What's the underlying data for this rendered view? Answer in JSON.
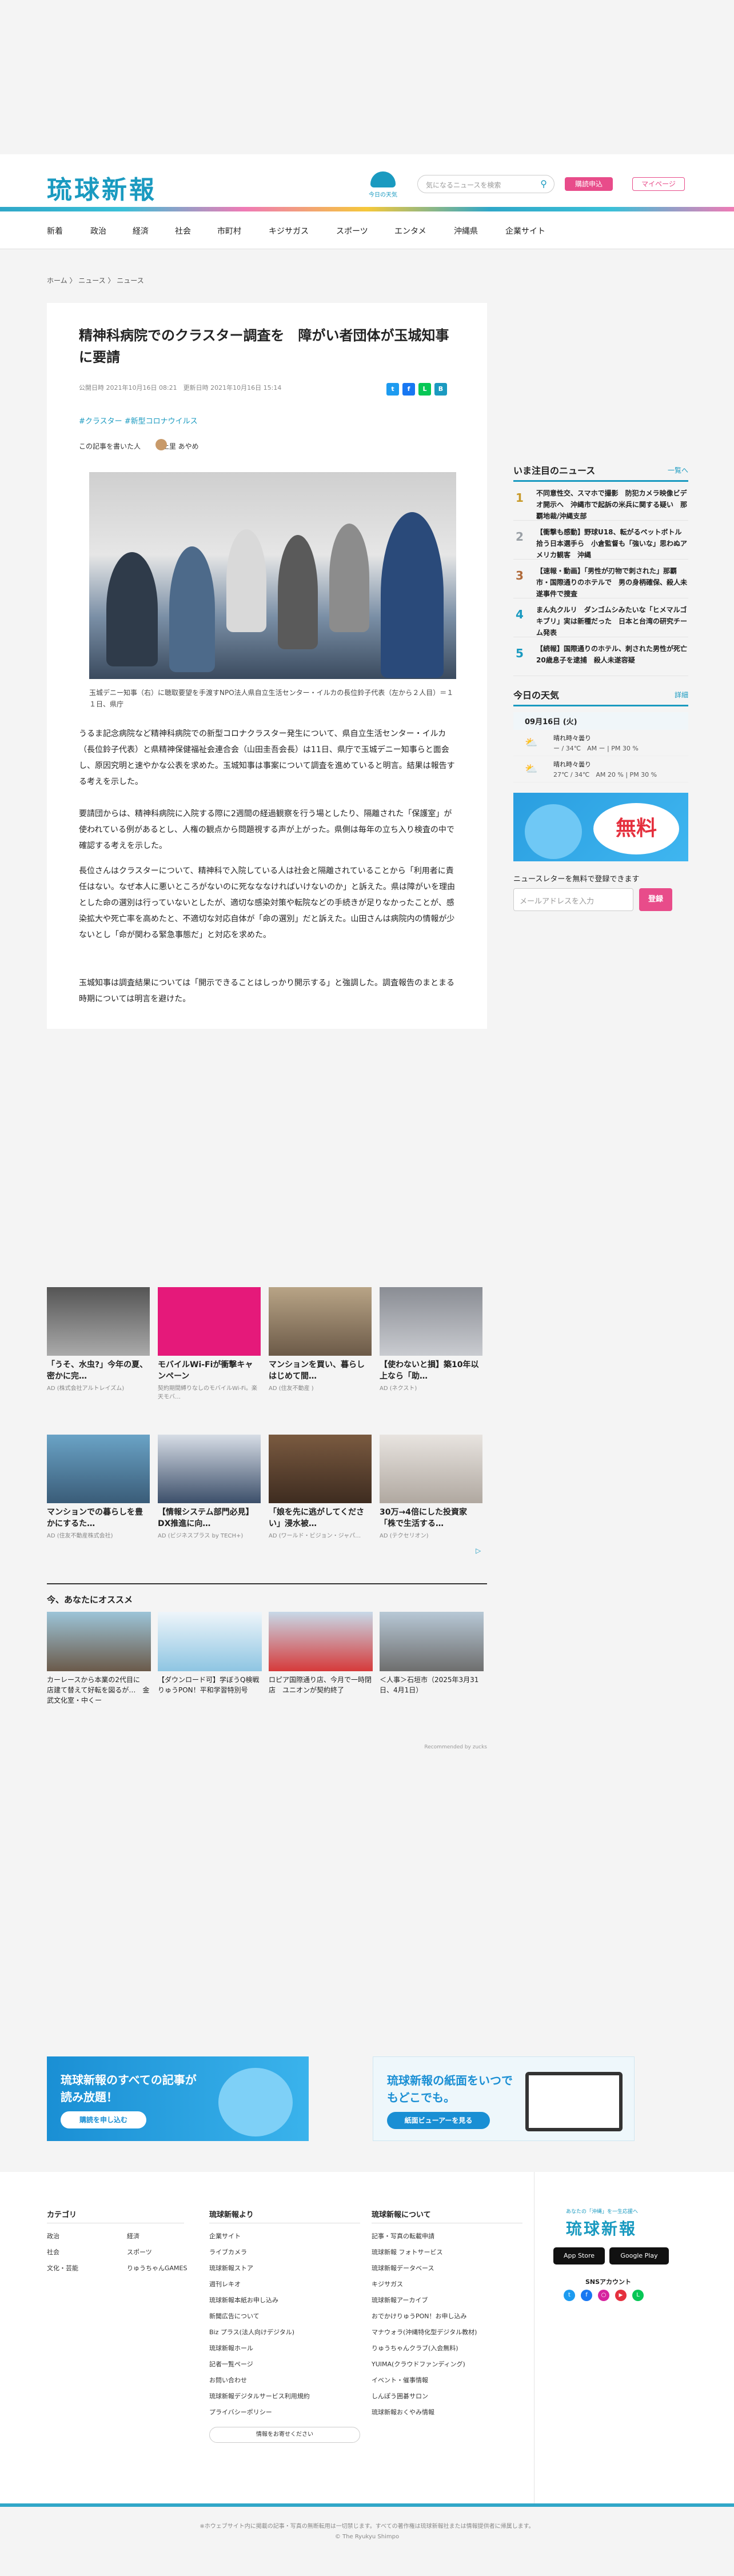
{
  "header": {
    "logo": "琉球新報",
    "weather_label": "今日の天気",
    "search_placeholder": "気になるニュースを検索",
    "apply": "購読申込",
    "mypage": "マイページ"
  },
  "nav": [
    "新着",
    "政治",
    "経済",
    "社会",
    "市町村",
    "キジサガス",
    "スポーツ",
    "エンタメ",
    "沖縄県",
    "企業サイト"
  ],
  "breadcrumb": "ホーム  〉 ニュース 〉 ニュース",
  "article": {
    "title": "精神科病院でのクラスター調査を　障がい者団体が玉城知事に要請",
    "dates": "公開日時 2021年10月16日 08:21　更新日時 2021年10月16日 15:14",
    "tags": "#クラスター  #新型コロナウイルス",
    "author_prefix": "この記事を書いた人",
    "author": "上里 あやめ",
    "caption": "玉城デニー知事（右）に聴取要望を手渡すNPO法人県自立生活センター・イルカの長位鈴子代表（左から２人目）＝１１日、県庁",
    "paragraphs": [
      "うるま記念病院など精神科病院での新型コロナクラスター発生について、県自立生活センター・イルカ（長位鈴子代表）と県精神保健福祉会連合会（山田圭吾会長）は11日、県庁で玉城デニー知事らと面会し、原因究明と速やかな公表を求めた。玉城知事は事案について調査を進めていると明言。結果は報告する考えを示した。",
      "要請団からは、精神科病院に入院する際に2週間の経過観察を行う場としたり、隔離された「保護室」が使われている例があるとし、人権の観点から問題視する声が上がった。県側は毎年の立ち入り検査の中で確認する考えを示した。",
      "長位さんはクラスターについて、精神科で入院している人は社会と隔離されていることから「利用者に責任はない。なぜ本人に悪いところがないのに死なななければいけないのか」と訴えた。県は障がいを理由とした命の選別は行っていないとしたが、適切な感染対策や転院などの手続きが足りなかったことが、感染拡大や死亡率を高めたと、不適切な対応自体が「命の選別」だと訴えた。山田さんは病院内の情報が少ないとし「命が関わる緊急事態だ」と対応を求めた。",
      "玉城知事は調査結果については「開示できることはしっかり開示する」と強調した。調査報告のまとまる時期については明言を避けた。"
    ]
  },
  "sidebar": {
    "news_heading": "いま注目のニュース",
    "news_more": "一覧へ",
    "news": [
      "不同意性交、スマホで撮影　防犯カメラ映像ビデオ開示へ　沖縄市で起訴の米兵に関する疑い　那覇地裁/沖縄支部",
      "【衝撃も感動】野球U18、転がるペットボトル拾う日本選手ら　小倉監督も「強いな」思わぬアメリカ観客　沖縄",
      "【速報・動画】「男性が刃物で刺された」那覇市・国際通りのホテルで　男の身柄確保、殺人未遂事件で捜査",
      "まん丸クルリ　ダンゴムシみたいな「ヒメマルゴキブリ」実は新種だった　日本と台湾の研究チーム発表",
      "【続報】国際通りのホテル、刺された男性が死亡　20歳息子を逮捕　殺人未遂容疑"
    ],
    "weather_heading": "今日の天気",
    "weather_more": "詳細",
    "weather_date": "09月16日 (火)",
    "weather_rows": [
      {
        "t": "晴れ時々曇り",
        "d": "ー / 34℃　AM ー  |  PM 30 %"
      },
      {
        "t": "晴れ時々曇り",
        "d": "27℃ / 34℃　AM 20 %  |  PM 30 %"
      }
    ],
    "banner_text": "無料",
    "newsletter_heading": "ニュースレターを無料で登録できます",
    "newsletter_placeholder": "メールアドレスを入力",
    "newsletter_button": "登録"
  },
  "recommend": [
    {
      "t": "「うそ、水虫?」今年の夏、密かに完…",
      "s": "AD (株式会社アルトレイズム)"
    },
    {
      "t": "モバイルWi-Fiが衝撃キャンペーン",
      "s": "契約期間縛りなしのモバイルWi-Fi。楽天モバ…"
    },
    {
      "t": "マンションを買い、暮らしはじめて間…",
      "s": "AD (住友不動産 )"
    },
    {
      "t": "【使わないと損】築10年以上なら「助…",
      "s": "AD (ネクスト)"
    },
    {
      "t": "マンションでの暮らしを豊かにするた…",
      "s": "AD (住友不動産株式会社)"
    },
    {
      "t": "【情報システム部門必見】DX推進に向…",
      "s": "AD (ビジネスプラス by TECH+)"
    },
    {
      "t": "「娘を先に逃がしてください」浸水被…",
      "s": "AD (ワールド・ビジョン・ジャパ…"
    },
    {
      "t": "30万→4倍にした投資家「株で生活する…",
      "s": "AD (テクセリオン)"
    }
  ],
  "osusume_heading": "今、あなたにオススメ",
  "osusume": [
    "カーレースから本業の2代目に　店建て替えて好転を図るが…　金武文化室・中くー",
    "【ダウンロード可】学ぼうQ検戦　りゅうPON！平和学習特別号",
    "ロピア国際通り店、今月で一時閉店　ユニオンが契約終了",
    "＜人事＞石垣市（2025年3月31日、4月1日）"
  ],
  "powered": "Recommended by zucks",
  "banners": [
    {
      "title": "琉球新報のすべての記事が読み放題！",
      "btn": "購読を申し込む"
    },
    {
      "title": "琉球新報の紙面をいつでもどこでも。",
      "btn": "紙面ビューアーを見る"
    }
  ],
  "footer": {
    "col1_heading": "カテゴリ",
    "col1": [
      "政治",
      "社会",
      "文化・芸能",
      "経済",
      "スポーツ",
      "りゅうちゃんGAMES"
    ],
    "col2_heading": "琉球新報より",
    "col2": [
      "企業サイト",
      "ライブカメラ",
      "琉球新報ストア",
      "週刊レキオ",
      "琉球新報本紙お申し込み",
      "新聞広告について",
      "Biz プラス(法人向けデジタル)",
      "琉球新報ホール",
      "記者一覧ページ",
      "お問い合わせ",
      "琉球新報デジタルサービス利用規約",
      "プライバシーポリシー"
    ],
    "col2_button": "情報をお寄せください",
    "col3_heading": "琉球新報について",
    "col3": [
      "記事・写真の転載申請",
      "琉球新報 フォトサービス",
      "琉球新報データベース",
      "キジサガス",
      "琉球新報アーカイブ",
      "おでかけりゅうPON！お申し込み",
      "マナウォラ(沖縄特化型デジタル教材)",
      "りゅうちゃんクラブ(入会無料)",
      "YUIMA(クラウドファンディング)",
      "イベント・催事情報",
      "しんぽう囲碁サロン",
      "琉球新報おくやみ情報"
    ],
    "brand_tag": "あなたの「沖縄」を一生応援へ",
    "brand_logo": "琉球新報",
    "app_store": "App Store",
    "google_play": "Google Play",
    "sns_heading": "SNSアカウント",
    "copyright_note": "※ホウェブサイト内に掲載の記事・写真の無断転用は一切禁じます。すべての著作権は琉球新報社または情報提供者に帰属します。",
    "copyright": "© The Ryukyu Shimpo"
  },
  "colors": {
    "brand": "#1a9ac0",
    "accent": "#e84c8a"
  }
}
